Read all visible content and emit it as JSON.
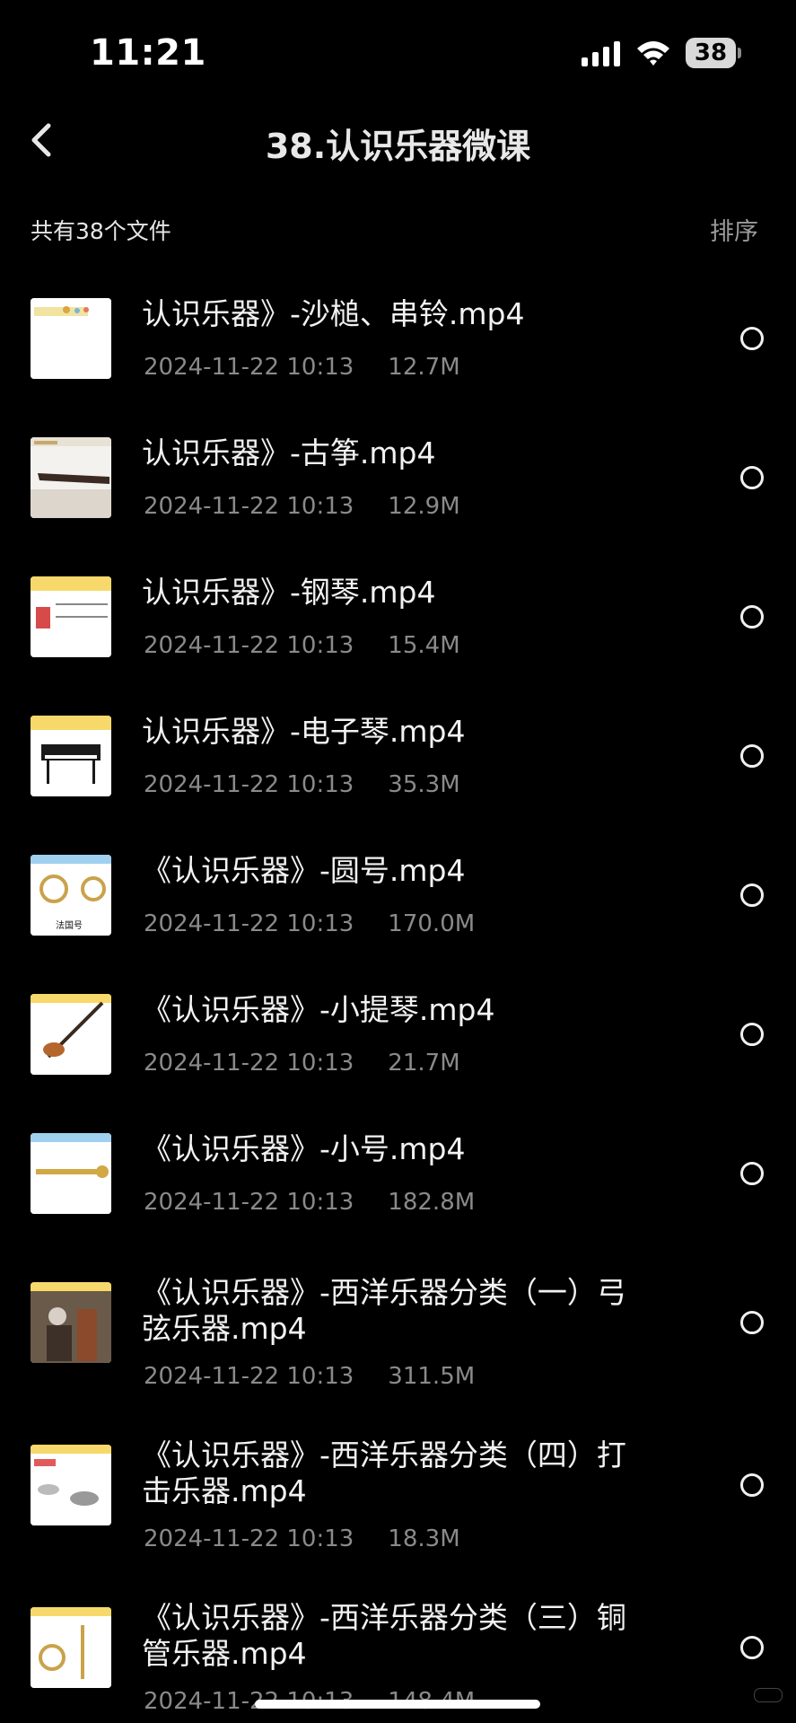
{
  "status_bar": {
    "time": "11:21",
    "battery_level": "38",
    "icons": [
      "signal-icon",
      "wifi-icon",
      "battery-icon"
    ]
  },
  "header": {
    "back_icon": "chevron-left-icon",
    "title": "38.认识乐器微课"
  },
  "summary": {
    "file_count_text": "共有38个文件",
    "sort_label": "排序"
  },
  "files": [
    {
      "name": "认识乐器》-沙槌、串铃.mp4",
      "date": "2024-11-22 10:13",
      "size": "12.7M"
    },
    {
      "name": "认识乐器》-古筝.mp4",
      "date": "2024-11-22 10:13",
      "size": "12.9M"
    },
    {
      "name": "认识乐器》-钢琴.mp4",
      "date": "2024-11-22 10:13",
      "size": "15.4M"
    },
    {
      "name": "认识乐器》-电子琴.mp4",
      "date": "2024-11-22 10:13",
      "size": "35.3M"
    },
    {
      "name": "《认识乐器》-圆号.mp4",
      "date": "2024-11-22 10:13",
      "size": "170.0M",
      "thumb_caption": "法国号"
    },
    {
      "name": "《认识乐器》-小提琴.mp4",
      "date": "2024-11-22 10:13",
      "size": "21.7M"
    },
    {
      "name": "《认识乐器》-小号.mp4",
      "date": "2024-11-22 10:13",
      "size": "182.8M"
    },
    {
      "name": "《认识乐器》-西洋乐器分类（一）弓弦乐器.mp4",
      "date": "2024-11-22 10:13",
      "size": "311.5M"
    },
    {
      "name": "《认识乐器》-西洋乐器分类（四）打击乐器.mp4",
      "date": "2024-11-22 10:13",
      "size": "18.3M"
    },
    {
      "name": "《认识乐器》-西洋乐器分类（三）铜管乐器.mp4",
      "date": "2024-11-22 10:13",
      "size": "148.4M"
    }
  ],
  "colors": {
    "background": "#000000",
    "primary_text": "#f2f2f2",
    "secondary_text": "#8a8a8a"
  }
}
